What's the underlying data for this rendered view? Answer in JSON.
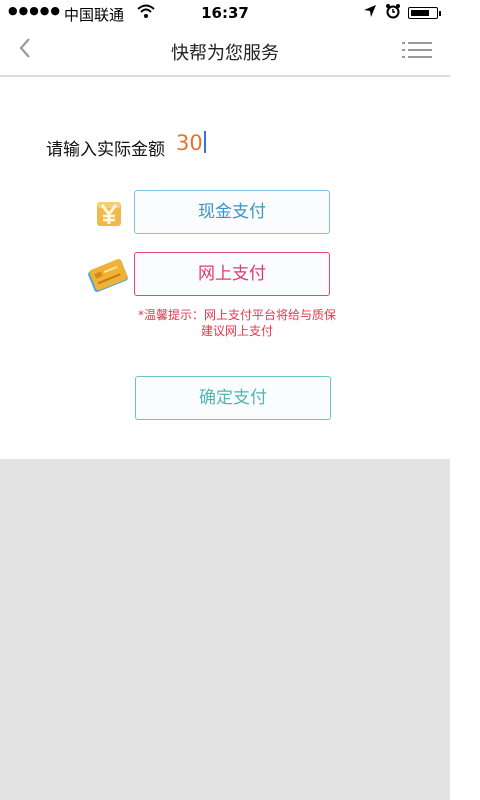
{
  "status_bar": {
    "signal": "●●●●●",
    "carrier": "中国联通",
    "time": "16:37"
  },
  "nav": {
    "title": "快帮为您服务"
  },
  "form": {
    "amount_label": "请输入实际金额",
    "amount_value": "30"
  },
  "payment": {
    "cash_label": "现金支付",
    "online_label": "网上支付",
    "tip": "*温馨提示：网上支付平台将给与质保建议网上支付",
    "tip_line1": "*温馨提示：网上支付平台将给与质保",
    "tip_line2": "建议网上支付",
    "confirm_label": "确定支付"
  },
  "colors": {
    "accent_blue": "#3c93c6",
    "accent_pink": "#e03a6c",
    "accent_teal": "#52b6b2",
    "amount_orange": "#e8742b",
    "background_gray": "#e3e3e3"
  },
  "icons": {
    "back": "chevron-left-icon",
    "menu": "list-menu-icon",
    "cash": "yuan-coin-icon",
    "online": "bank-card-icon",
    "wifi": "wifi-icon",
    "location": "location-arrow-icon",
    "alarm": "alarm-clock-icon",
    "battery": "battery-icon"
  }
}
